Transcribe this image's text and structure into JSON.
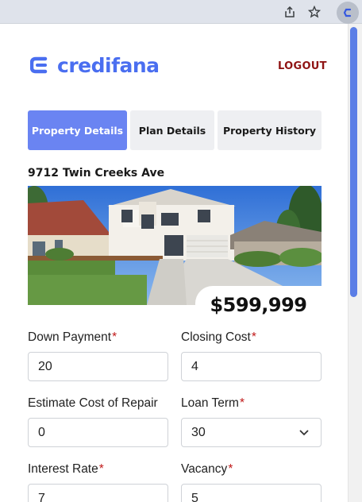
{
  "browser": {
    "icons": [
      "share-icon",
      "star-icon",
      "extension-icon"
    ]
  },
  "header": {
    "logo_text": "credifana",
    "logout_label": "LOGOUT",
    "brand_color": "#4a6ef0"
  },
  "tabs": [
    {
      "label": "Property Details",
      "active": true
    },
    {
      "label": "Plan Details",
      "active": false
    },
    {
      "label": "Property History",
      "active": false
    }
  ],
  "property": {
    "address": "9712 Twin Creeks Ave",
    "price": "$599,999"
  },
  "form": {
    "down_payment": {
      "label": "Down Payment",
      "required": "*",
      "value": "20"
    },
    "closing_cost": {
      "label": "Closing Cost",
      "required": "*",
      "value": "4"
    },
    "repair_cost": {
      "label": "Estimate Cost of Repair",
      "value": "0"
    },
    "loan_term": {
      "label": "Loan Term",
      "required": "*",
      "value": "30"
    },
    "interest_rate": {
      "label": "Interest Rate",
      "required": "*",
      "value": "7"
    },
    "vacancy": {
      "label": "Vacancy",
      "required": "*",
      "value": "5"
    }
  }
}
